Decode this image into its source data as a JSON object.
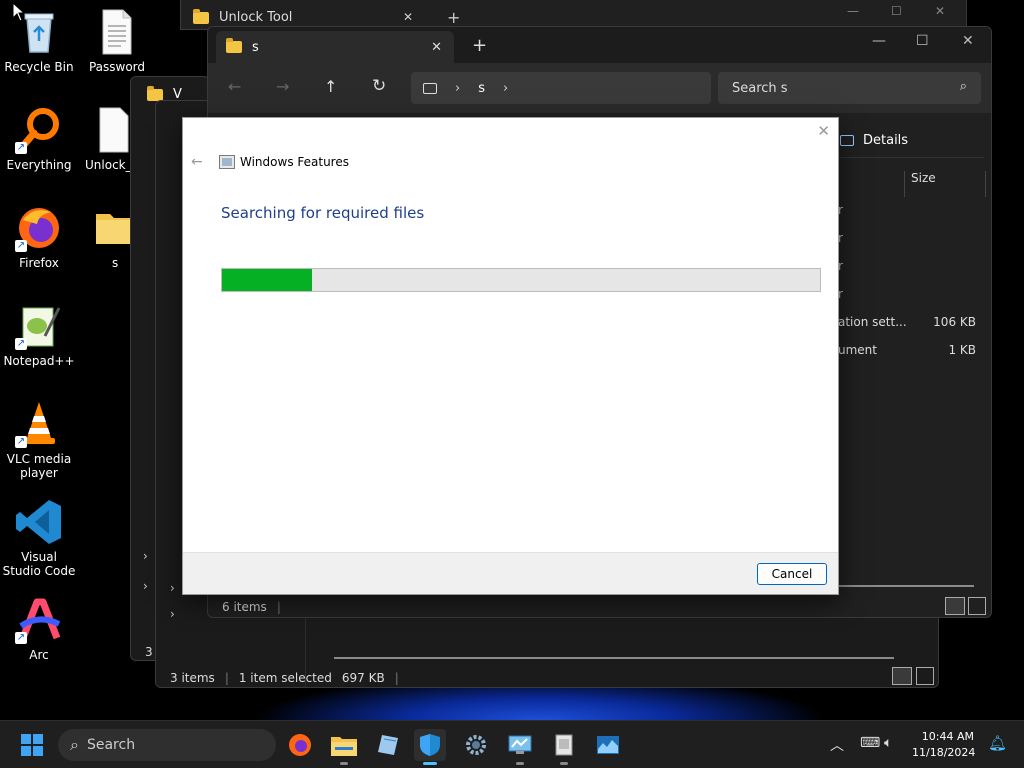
{
  "desktop": {
    "icons": [
      {
        "label": "Recycle Bin"
      },
      {
        "label": "Password"
      },
      {
        "label": "Everything"
      },
      {
        "label": "Unlock_T"
      },
      {
        "label": "Firefox"
      },
      {
        "label": "s"
      },
      {
        "label": "Notepad++"
      },
      {
        "label": "VLC media player"
      },
      {
        "label": "Visual Studio Code"
      },
      {
        "label": "Arc"
      }
    ]
  },
  "back_window": {
    "tab_title": "Unlock Tool",
    "status": {
      "items": "3 items",
      "selected": "1 item selected",
      "size": "697 KB"
    }
  },
  "mid_window": {
    "tab_partial": "V",
    "status_partial": "3"
  },
  "front_window": {
    "tab_title": "s",
    "address_segment": "s",
    "search_placeholder": "Search s",
    "details_label": "Details",
    "size_header": "Size",
    "rows": [
      {
        "type": "r",
        "size": ""
      },
      {
        "type": "r",
        "size": ""
      },
      {
        "type": "r",
        "size": ""
      },
      {
        "type": "r",
        "size": ""
      },
      {
        "type": "ation sett...",
        "size": "106 KB"
      },
      {
        "type": "ument",
        "size": "1 KB"
      }
    ],
    "status_items": "6 items"
  },
  "dialog": {
    "title": "Windows Features",
    "heading": "Searching for required files",
    "progress": 0.15,
    "cancel_label": "Cancel"
  },
  "taskbar": {
    "search_label": "Search",
    "time": "10:44 AM",
    "date": "11/18/2024"
  },
  "colors": {
    "progress_green": "#06b025",
    "heading_blue": "#1e3f8a",
    "accent": "#0067c0"
  }
}
